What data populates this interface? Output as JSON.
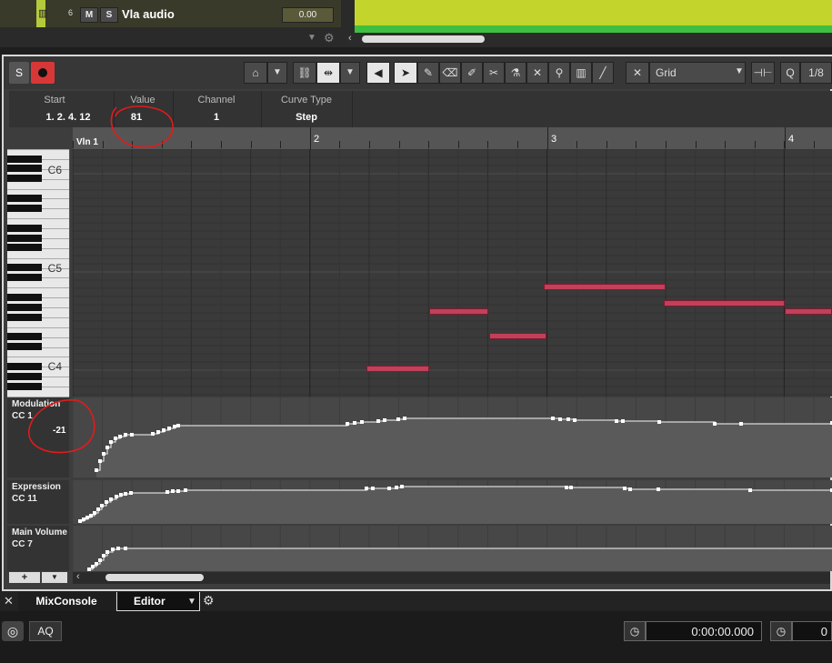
{
  "track": {
    "number": "6",
    "mute_label": "M",
    "solo_label": "S",
    "name": "Vla audio",
    "volume": "0.00"
  },
  "toolbar": {
    "solo_label": "S",
    "snap_type": "Grid",
    "quantize_label": "Q",
    "quantize_value": "1/8"
  },
  "infoline": {
    "start_label": "Start",
    "start_value": "1. 2. 4. 12",
    "value_label": "Value",
    "value_value": "81",
    "channel_label": "Channel",
    "channel_value": "1",
    "curve_label": "Curve Type",
    "curve_value": "Step"
  },
  "ruler": {
    "part_name": "Vln 1",
    "bars": [
      "2",
      "3",
      "4"
    ]
  },
  "piano": {
    "labels": [
      "C6",
      "C5",
      "C4"
    ]
  },
  "lanes": {
    "modulation": {
      "title": "Modulation",
      "cc": "CC 1",
      "value": "-21"
    },
    "expression": {
      "title": "Expression",
      "cc": "CC 11"
    },
    "volume": {
      "title": "Main Volume",
      "cc": "CC 7"
    }
  },
  "lane_controls": {
    "add_label": "+",
    "menu_label": "▼"
  },
  "bottom_tabs": {
    "mixconsole": "MixConsole",
    "editor": "Editor"
  },
  "transport": {
    "aq_label": "AQ",
    "time": "0:00:00.000",
    "time2": "0"
  },
  "colors": {
    "note": "#c2405a",
    "annotation": "#e21b1b",
    "track": "#c3d52c"
  }
}
